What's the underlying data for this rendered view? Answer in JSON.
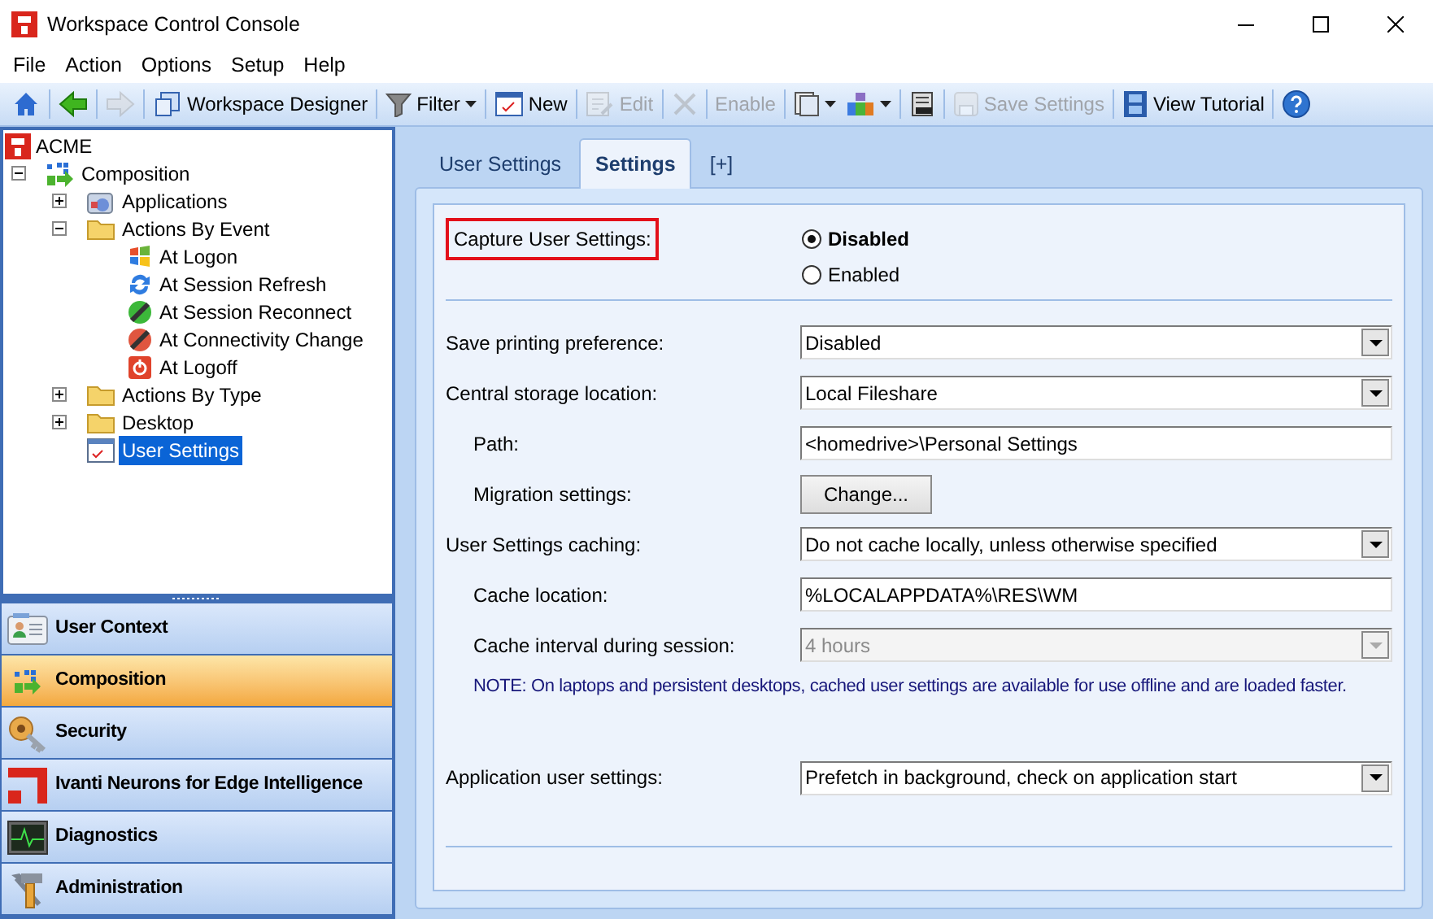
{
  "window": {
    "title": "Workspace Control Console"
  },
  "menu": [
    "File",
    "Action",
    "Options",
    "Setup",
    "Help"
  ],
  "toolbar": [
    {
      "kind": "home",
      "disabled": false
    },
    {
      "kind": "back",
      "disabled": false
    },
    {
      "kind": "forward",
      "disabled": true
    },
    {
      "kind": "designer",
      "label": "Workspace Designer",
      "disabled": false
    },
    {
      "kind": "filter",
      "label": "Filter",
      "dropdown": true,
      "disabled": false
    },
    {
      "kind": "new",
      "label": "New",
      "disabled": false
    },
    {
      "kind": "edit",
      "label": "Edit",
      "disabled": true
    },
    {
      "kind": "delete",
      "disabled": true
    },
    {
      "kind": "enable",
      "label": "Enable",
      "disabled": true
    },
    {
      "kind": "pages",
      "dropdown": true,
      "disabled": false
    },
    {
      "kind": "blocks",
      "dropdown": true,
      "disabled": false
    },
    {
      "kind": "server",
      "disabled": false
    },
    {
      "kind": "save",
      "label": "Save Settings",
      "disabled": true
    },
    {
      "kind": "film",
      "label": "View Tutorial",
      "disabled": false
    },
    {
      "kind": "help",
      "disabled": false
    }
  ],
  "tree": {
    "label": "ACME",
    "children": [
      {
        "label": "Composition",
        "kind": "composition",
        "expanded": true,
        "selected": false,
        "children": [
          {
            "label": "Applications",
            "kind": "apps",
            "expanded": false,
            "selected": false
          },
          {
            "label": "Actions By Event",
            "kind": "folder",
            "expanded": true,
            "selected": false,
            "children": [
              {
                "label": "At Logon",
                "kind": "logon",
                "selected": false
              },
              {
                "label": "At Session Refresh",
                "kind": "refresh",
                "selected": false
              },
              {
                "label": "At Session Reconnect",
                "kind": "reconnect",
                "selected": false
              },
              {
                "label": "At Connectivity Change",
                "kind": "connectivity",
                "selected": false
              },
              {
                "label": "At Logoff",
                "kind": "logoff",
                "selected": false
              }
            ]
          },
          {
            "label": "Actions By Type",
            "kind": "folder",
            "expanded": false,
            "selected": false
          },
          {
            "label": "Desktop",
            "kind": "folder",
            "expanded": false,
            "selected": false
          },
          {
            "label": "User Settings",
            "kind": "settings",
            "selected": true
          }
        ]
      }
    ]
  },
  "nav": [
    {
      "label": "User Context",
      "kind": "user",
      "selected": false
    },
    {
      "label": "Composition",
      "kind": "composition",
      "selected": true
    },
    {
      "label": "Security",
      "kind": "security",
      "selected": false
    },
    {
      "label": "Ivanti Neurons for Edge Intelligence",
      "kind": "ivanti",
      "selected": false
    },
    {
      "label": "Diagnostics",
      "kind": "diagnostics",
      "selected": false
    },
    {
      "label": "Administration",
      "kind": "admin",
      "selected": false
    }
  ],
  "tabs": [
    {
      "label": "User Settings",
      "selected": false
    },
    {
      "label": "Settings",
      "selected": true
    },
    {
      "label": "[+]",
      "selected": false
    }
  ],
  "form": [
    {
      "kind": "radio",
      "label": "Capture User Settings:",
      "highlighted": true,
      "options": [
        {
          "label": "Disabled",
          "selected": true
        },
        {
          "label": "Enabled",
          "selected": false
        }
      ]
    },
    {
      "kind": "divider"
    },
    {
      "kind": "select",
      "label": "Save printing preference:",
      "value": "Disabled",
      "disabled": false
    },
    {
      "kind": "select",
      "label": "Central storage location:",
      "value": "Local Fileshare",
      "disabled": false,
      "children": [
        {
          "kind": "text",
          "label": "Path:",
          "value": "<homedrive>\\Personal Settings"
        },
        {
          "kind": "button",
          "label": "Migration settings:",
          "button": "Change..."
        }
      ]
    },
    {
      "kind": "select",
      "label": "User Settings caching:",
      "value": "Do not cache locally, unless otherwise specified",
      "disabled": false,
      "children": [
        {
          "kind": "text",
          "label": "Cache location:",
          "value": "%LOCALAPPDATA%\\RES\\WM"
        },
        {
          "kind": "select",
          "label": "Cache interval during session:",
          "value": "4 hours",
          "disabled": true
        },
        {
          "kind": "note",
          "text": "NOTE: On laptops and persistent desktops, cached user settings are available for use offline and are loaded faster."
        }
      ]
    },
    {
      "kind": "spacer"
    },
    {
      "kind": "select",
      "label": "Application user settings:",
      "value": "Prefetch in background, check on application start",
      "disabled": false
    }
  ]
}
